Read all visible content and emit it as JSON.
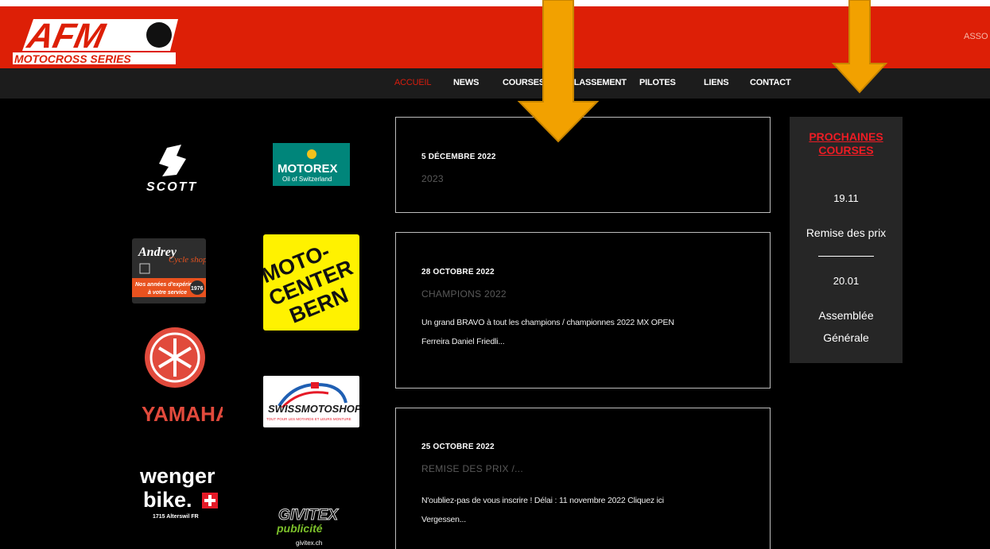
{
  "header": {
    "logo_text_main": "AFM",
    "logo_text_sub": "MOTOCROSS SERIES",
    "asso_text": "ASSO"
  },
  "nav": {
    "items": [
      {
        "label": "ACCUEIL",
        "active": true
      },
      {
        "label": "NEWS",
        "active": false
      },
      {
        "label": "COURSES",
        "active": false
      },
      {
        "label": "CLASSEMENT",
        "active": false
      },
      {
        "label": "PILOTES",
        "active": false
      },
      {
        "label": "LIENS",
        "active": false
      },
      {
        "label": "CONTACT",
        "active": false
      }
    ]
  },
  "sponsors": {
    "scott": "SCOTT",
    "motorex_main": "MOTOREX",
    "motorex_sub": "Oil of Switzerland",
    "andrey_main": "Andrey",
    "andrey_sub": "Cycle shop",
    "andrey_tag1": "Nos années d'expérience",
    "andrey_tag2": "à votre service",
    "andrey_year": "1976",
    "motocenter_1": "MOTO-",
    "motocenter_2": "CENTER",
    "motocenter_3": "BERN",
    "yamaha": "YAMAHA",
    "swissmotoshop": "SWISSMOTOSHOP",
    "swissmotoshop_sub": "TOUT POUR LES MOTARDS ET LEURS MONTURE",
    "wenger_1": "wenger",
    "wenger_2": "bike.",
    "wenger_addr": "1715 Alterswil FR",
    "givitex_1": "GIVITEX",
    "givitex_2": "publicité",
    "givitex_3": "givitex.ch"
  },
  "posts": [
    {
      "date": "5 DÉCEMBRE 2022",
      "title": "2023",
      "excerpt_1": "",
      "excerpt_2": ""
    },
    {
      "date": "28 OCTOBRE 2022",
      "title": "CHAMPIONS 2022",
      "excerpt_1": "Un grand BRAVO à tout les champions / championnes 2022 MX OPEN",
      "excerpt_2": "Ferreira Daniel Friedli..."
    },
    {
      "date": "25 OCTOBRE 2022",
      "title": "REMISE DES PRIX /...",
      "excerpt_1": "N'oubliez-pas de vous inscrire ! Délai : 11 novembre 2022 Cliquez ici",
      "excerpt_2": "Vergessen..."
    }
  ],
  "sidebar": {
    "heading_1": "PROCHAINES",
    "heading_2": "COURSES",
    "events": [
      {
        "date": "19.11",
        "label_1": "Remise des prix",
        "label_2": ""
      },
      {
        "date": "20.01",
        "label_1": "Assemblée",
        "label_2": "Générale"
      }
    ]
  },
  "colors": {
    "red_bar": "#dd1f06",
    "nav_active": "#d91d0e",
    "arrow": "#f2a100",
    "arrow_edge": "#c98600"
  }
}
